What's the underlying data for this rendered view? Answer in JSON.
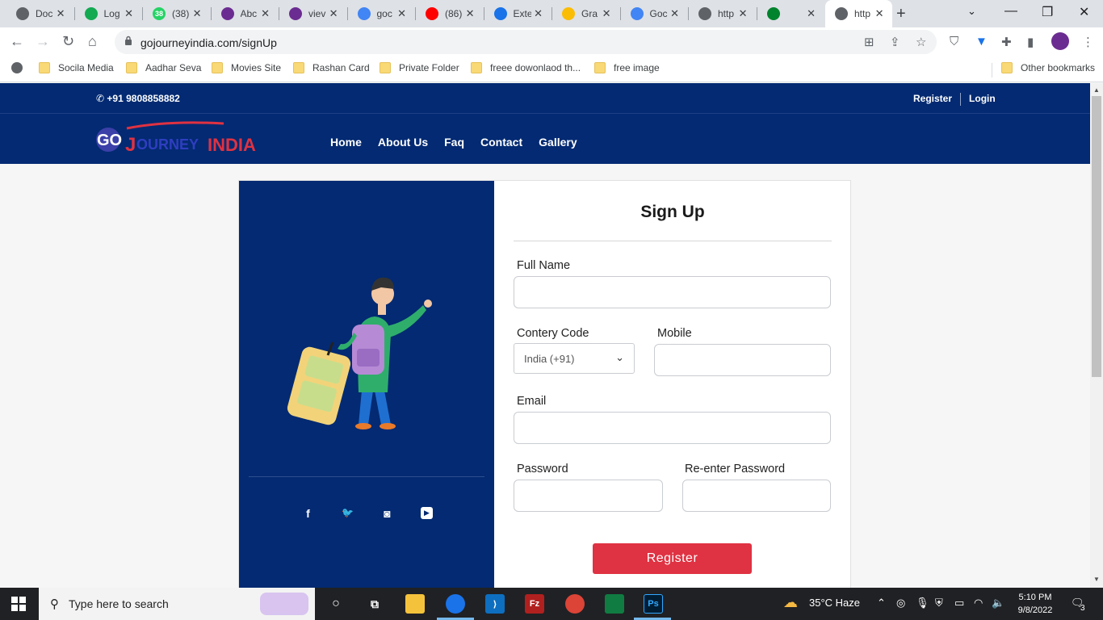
{
  "browser": {
    "tabs": [
      {
        "title": "Doc",
        "favicon": "globe-icon",
        "color": "#5f6368"
      },
      {
        "title": "Log",
        "favicon": "mongodb-leaf-icon",
        "color": "#13aa52"
      },
      {
        "title": "(38)",
        "favicon": "whatsapp-icon",
        "color": "#25d366",
        "badge": "38"
      },
      {
        "title": "Abc",
        "favicon": "m-logo-icon",
        "color": "#6b2c91"
      },
      {
        "title": "viev",
        "favicon": "m-logo-icon",
        "color": "#6b2c91"
      },
      {
        "title": "goc",
        "favicon": "google-icon",
        "color": "#4285f4"
      },
      {
        "title": "(86)",
        "favicon": "youtube-icon",
        "color": "#ff0000"
      },
      {
        "title": "Exte",
        "favicon": "puzzle-icon",
        "color": "#1a73e8"
      },
      {
        "title": "Gra",
        "favicon": "drive-icon",
        "color": "#fbbc04"
      },
      {
        "title": "Goc",
        "favicon": "google-icon",
        "color": "#4285f4"
      },
      {
        "title": "http",
        "favicon": "globe-icon",
        "color": "#5f6368"
      },
      {
        "title": "",
        "favicon": "meet-icon",
        "color": "#00832d"
      },
      {
        "title": "http",
        "favicon": "globe-icon",
        "color": "#5f6368",
        "active": true
      }
    ],
    "url": "gojourneyindia.com/signUp",
    "bookmarks": [
      "Socila Media",
      "Aadhar Seva",
      "Movies Site",
      "Rashan Card",
      "Private Folder",
      "freee dowonlaod th...",
      "free image"
    ],
    "other_bookmarks": "Other bookmarks"
  },
  "site": {
    "phone": "+91 9808858882",
    "register_link": "Register",
    "login_link": "Login",
    "logo_text": "GO JOURNEY INDIA",
    "nav": [
      "Home",
      "About Us",
      "Faq",
      "Contact",
      "Gallery"
    ],
    "brand_color": "#032a72",
    "accent_color": "#df3242"
  },
  "signup": {
    "title": "Sign Up",
    "full_name_label": "Full Name",
    "full_name_value": "",
    "country_code_label": "Contery Code",
    "country_code_value": "India (+91)",
    "mobile_label": "Mobile",
    "mobile_value": "",
    "email_label": "Email",
    "email_value": "",
    "password_label": "Password",
    "password_value": "",
    "reenter_label": "Re-enter Password",
    "reenter_value": "",
    "register_button": "Register",
    "socials": [
      "facebook-icon",
      "twitter-icon",
      "instagram-icon",
      "youtube-icon"
    ]
  },
  "taskbar": {
    "search_placeholder": "Type here to search",
    "weather": "35°C  Haze",
    "time": "5:10 PM",
    "date": "9/8/2022",
    "notifications": "3"
  }
}
